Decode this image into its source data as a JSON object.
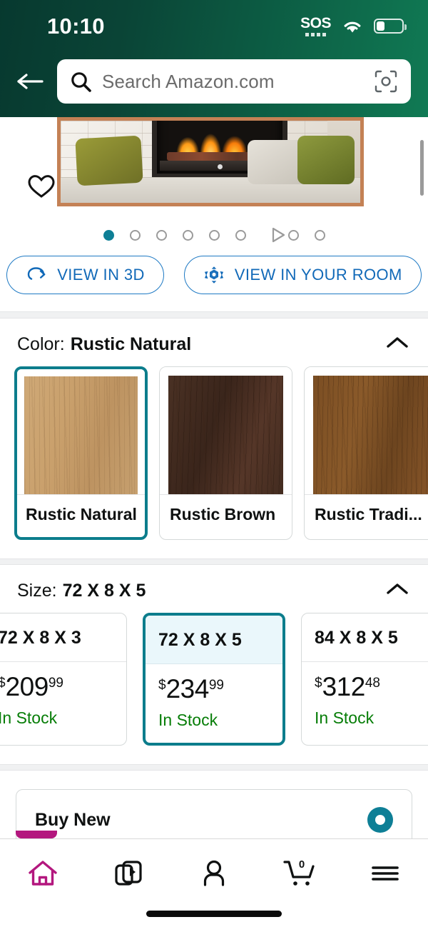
{
  "status_bar": {
    "time": "10:10",
    "sos_label": "SOS",
    "wifi_icon": "wifi-icon",
    "battery_icon": "battery-icon",
    "battery_level_pct": 33
  },
  "header": {
    "back_icon": "arrow-left-icon",
    "search": {
      "placeholder": "Search Amazon.com",
      "value": "",
      "search_icon": "search-icon",
      "camera_icon": "camera-scan-icon"
    },
    "bg_start_color": "#07392f",
    "bg_end_color": "#107a54"
  },
  "gallery": {
    "wishlist_icon": "heart-icon",
    "scrollbar": "vertical-scrollbar",
    "dots": [
      {
        "type": "dot",
        "active": true
      },
      {
        "type": "dot",
        "active": false
      },
      {
        "type": "dot",
        "active": false
      },
      {
        "type": "dot",
        "active": false
      },
      {
        "type": "dot",
        "active": false
      },
      {
        "type": "dot",
        "active": false
      },
      {
        "type": "play",
        "active": false
      },
      {
        "type": "dot",
        "active": false
      },
      {
        "type": "dot",
        "active": false
      }
    ],
    "active_dot_color": "#0e7f96",
    "buttons": [
      {
        "label": "VIEW IN 3D",
        "icon": "rotate-3d-icon"
      },
      {
        "label": "VIEW IN YOUR ROOM",
        "icon": "ar-cube-icon"
      }
    ],
    "button_color": "#1169b8"
  },
  "color_section": {
    "label": "Color:",
    "selected": "Rustic Natural",
    "collapse_icon": "chevron-up-icon",
    "options": [
      {
        "name": "Rustic Natural",
        "swatch": "wood-natural",
        "selected": true
      },
      {
        "name": "Rustic Brown",
        "swatch": "wood-brown",
        "selected": false
      },
      {
        "name": "Rustic Tradi...",
        "swatch": "wood-trad",
        "selected": false
      }
    ]
  },
  "size_section": {
    "label": "Size:",
    "selected": "72 X 8 X 5",
    "collapse_icon": "chevron-up-icon",
    "options": [
      {
        "name": "72 X 8 X 3",
        "currency": "$",
        "whole": "209",
        "frac": "99",
        "stock": "In Stock",
        "selected": false
      },
      {
        "name": "72 X 8 X 5",
        "currency": "$",
        "whole": "234",
        "frac": "99",
        "stock": "In Stock",
        "selected": true
      },
      {
        "name": "84 X 8 X 5",
        "currency": "$",
        "whole": "312",
        "frac": "48",
        "stock": "In Stock",
        "selected": false
      }
    ],
    "selected_border_color": "#0c7d8c",
    "stock_color": "#067d07"
  },
  "buy_box": {
    "title": "Buy New",
    "radio_icon": "radio-selected-icon",
    "radio_color": "#0e7f96"
  },
  "bottom_nav": {
    "items": [
      {
        "icon": "home-icon",
        "name": "nav-home",
        "active": true
      },
      {
        "icon": "media-play-icon",
        "name": "nav-inspire",
        "active": false
      },
      {
        "icon": "person-icon",
        "name": "nav-account",
        "active": false
      },
      {
        "icon": "cart-icon",
        "name": "nav-cart",
        "active": false,
        "badge": "0"
      },
      {
        "icon": "hamburger-menu-icon",
        "name": "nav-menu",
        "active": false
      }
    ],
    "active_color": "#b3177e",
    "home_indicator": "home-indicator"
  }
}
